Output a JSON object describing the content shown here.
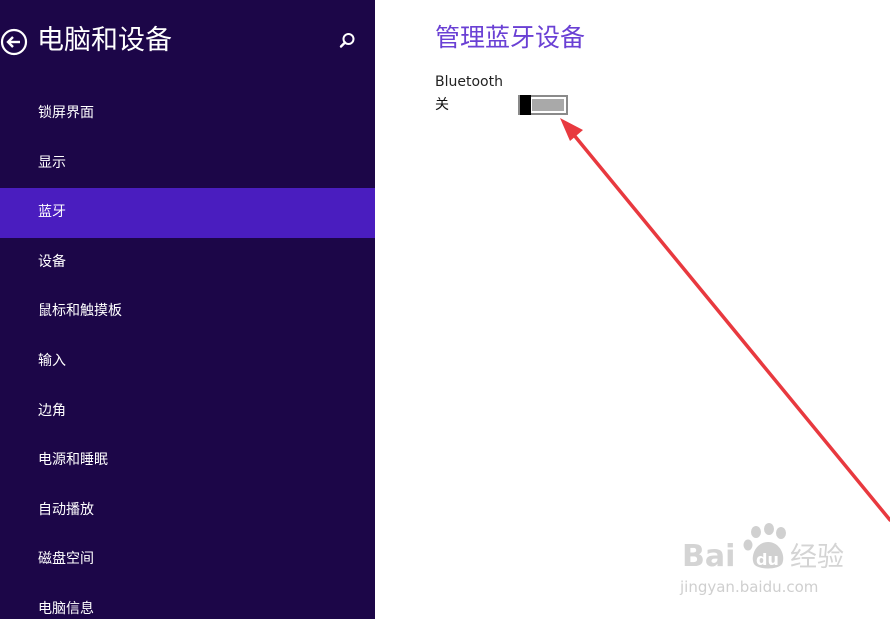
{
  "sidebar": {
    "title": "电脑和设备",
    "back_icon": "back-arrow-circle-icon",
    "search_icon": "search-icon",
    "items": [
      {
        "label": "锁屏界面",
        "active": false
      },
      {
        "label": "显示",
        "active": false
      },
      {
        "label": "蓝牙",
        "active": true
      },
      {
        "label": "设备",
        "active": false
      },
      {
        "label": "鼠标和触摸板",
        "active": false
      },
      {
        "label": "输入",
        "active": false
      },
      {
        "label": "边角",
        "active": false
      },
      {
        "label": "电源和睡眠",
        "active": false
      },
      {
        "label": "自动播放",
        "active": false
      },
      {
        "label": "磁盘空间",
        "active": false
      },
      {
        "label": "电脑信息",
        "active": false
      }
    ]
  },
  "content": {
    "title": "管理蓝牙设备",
    "bluetooth": {
      "label": "Bluetooth",
      "state_label": "关",
      "enabled": false
    }
  },
  "annotation": {
    "arrow_color": "#e8393f"
  },
  "watermark": {
    "brand": "Baidu经验",
    "url": "jingyan.baidu.com"
  },
  "colors": {
    "sidebar_bg": "#1c0648",
    "active_item_bg": "#4a1dbf",
    "accent_title": "#6a40d4"
  }
}
